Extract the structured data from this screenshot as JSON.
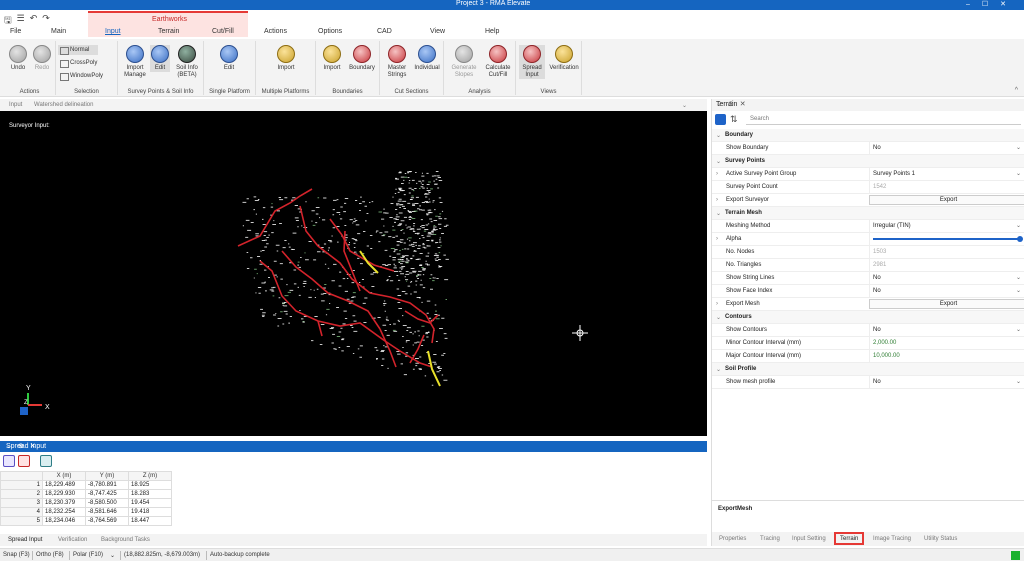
{
  "title_bar": {
    "title": "Project 3 - RMA Elevate"
  },
  "quick_access": {
    "icons": [
      "save-icon",
      "list-icon",
      "undo-icon",
      "redo-icon"
    ]
  },
  "context_tab": {
    "label": "Earthworks"
  },
  "menu_tabs": [
    "File",
    "Main",
    "Input",
    "Terrain",
    "Cut/Fill",
    "Actions",
    "Options",
    "CAD",
    "View",
    "Help"
  ],
  "active_menu_tab": "Input",
  "ribbon": {
    "actions": {
      "label": "Actions",
      "undo": "Undo",
      "redo": "Redo"
    },
    "selection": {
      "label": "Selection",
      "normal": "Normal",
      "crosspoly": "CrossPoly",
      "windowpoly": "WindowPoly"
    },
    "survey_points": {
      "label": "Survey Points & Soil Info",
      "import": "Import Manage",
      "edit": "Edit",
      "soil": "Soil Info (BETA)"
    },
    "single_platform": {
      "label": "Single Platform",
      "edit": "Edit"
    },
    "multiple_platforms": {
      "label": "Multiple Platforms",
      "import": "Import"
    },
    "boundaries": {
      "label": "Boundaries",
      "import": "Import",
      "boundary": "Boundary"
    },
    "cut_sections": {
      "label": "Cut Sections",
      "master": "Master Strings",
      "individual": "Individual"
    },
    "analysis": {
      "label": "Analysis",
      "generate": "Generate Slopes",
      "calculate": "Calculate Cut/Fill"
    },
    "views": {
      "label": "Views",
      "spread": "Spread Input",
      "verification": "Verification"
    }
  },
  "view_header": {
    "tab1": "Input",
    "tab2": "Watershed delineation"
  },
  "viewport": {
    "label": "Surveyor Input:",
    "axis_y": "Y",
    "axis_x": "X",
    "axis_z": "Z"
  },
  "spread_input": {
    "title": "Spread Input",
    "columns": [
      "X (m)",
      "Y (m)",
      "Z (m)"
    ],
    "rows": [
      {
        "n": "1",
        "x": "18,229.489",
        "y": "-8,780.891",
        "z": "18.925"
      },
      {
        "n": "2",
        "x": "18,229.930",
        "y": "-8,747.425",
        "z": "18.283"
      },
      {
        "n": "3",
        "x": "18,230.379",
        "y": "-8,580.500",
        "z": "19.454"
      },
      {
        "n": "4",
        "x": "18,232.254",
        "y": "-8,581.646",
        "z": "19.418"
      },
      {
        "n": "5",
        "x": "18,234.046",
        "y": "-8,764.569",
        "z": "18.447"
      }
    ]
  },
  "bottom_tabs": [
    "Spread Input",
    "Verification",
    "Background Tasks"
  ],
  "status": {
    "snap": "Snap (F3)",
    "ortho": "Ortho (F8)",
    "polar": "Polar (F10)",
    "coords": "(18,882.825m, -8,679.003m)",
    "message": "Auto-backup complete",
    "indicator_color": "#1bb12e"
  },
  "terrain_panel": {
    "title": "Terrain",
    "search_placeholder": "Search",
    "categories": {
      "boundary": "Boundary",
      "survey_points": "Survey Points",
      "terrain_mesh": "Terrain Mesh",
      "contours": "Contours",
      "soil_profile": "Soil Profile"
    },
    "props": {
      "show_boundary": {
        "label": "Show Boundary",
        "value": "No"
      },
      "active_group": {
        "label": "Active Survey Point Group",
        "value": "Survey Points 1"
      },
      "point_count": {
        "label": "Survey Point Count",
        "value": "1542"
      },
      "export_surveyor": {
        "label": "Export Surveyor",
        "value": "Export"
      },
      "meshing_method": {
        "label": "Meshing Method",
        "value": "Irregular (TIN)"
      },
      "alpha": {
        "label": "Alpha",
        "level": 1.0
      },
      "no_nodes": {
        "label": "No. Nodes",
        "value": "1503"
      },
      "no_triangles": {
        "label": "No. Triangles",
        "value": "2981"
      },
      "show_string_lines": {
        "label": "Show String Lines",
        "value": "No"
      },
      "show_face_index": {
        "label": "Show Face Index",
        "value": "No"
      },
      "export_mesh": {
        "label": "Export Mesh",
        "value": "Export"
      },
      "show_contours": {
        "label": "Show Contours",
        "value": "No"
      },
      "minor_interval": {
        "label": "Minor Contour Interval (mm)",
        "value": "2,000.00"
      },
      "major_interval": {
        "label": "Major Contour Interval (mm)",
        "value": "10,000.00"
      },
      "show_mesh_profile": {
        "label": "Show mesh profile",
        "value": "No"
      }
    },
    "description_title": "ExportMesh",
    "tabs": [
      "Properties",
      "Tracing",
      "Input Setting",
      "Terrain",
      "Image Tracing",
      "Utility Status"
    ],
    "active_tab": "Terrain"
  },
  "colors": {
    "accent": "#1565c0",
    "highlight": "#e53935",
    "green_value": "#2e7d32"
  }
}
